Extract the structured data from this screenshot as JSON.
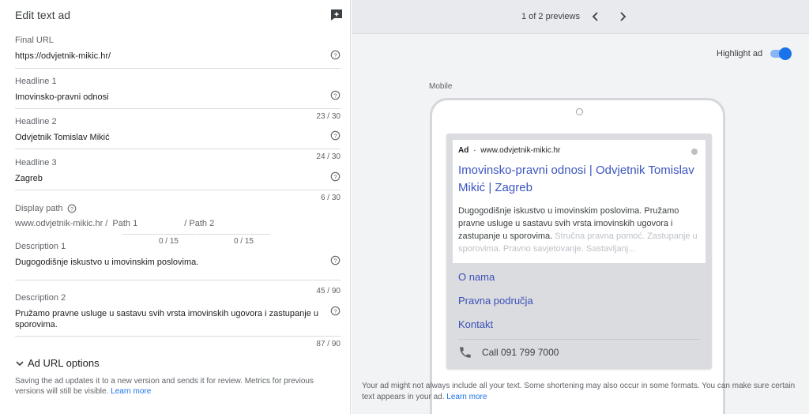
{
  "editor": {
    "title": "Edit text ad",
    "final_url": {
      "label": "Final URL",
      "value": "https://odvjetnik-mikic.hr/"
    },
    "headline1": {
      "label": "Headline 1",
      "value": "Imovinsko-pravni odnosi",
      "count": "23 / 30"
    },
    "headline2": {
      "label": "Headline 2",
      "value": "Odvjetnik Tomislav Mikić",
      "count": "24 / 30"
    },
    "headline3": {
      "label": "Headline 3",
      "value": "Zagreb",
      "count": "6 / 30"
    },
    "display_path": {
      "label": "Display path",
      "domain": "www.odvjetnik-mikic.hr /",
      "path1": "Path 1",
      "path2": "/ Path 2",
      "count1": "0 / 15",
      "count2": "0 / 15"
    },
    "description1": {
      "label": "Description 1",
      "value": "Dugogodišnje iskustvo u imovinskim poslovima.",
      "count": "45 / 90"
    },
    "description2": {
      "label": "Description 2",
      "value": "Pružamo pravne usluge u sastavu svih vrsta imovinskih ugovora i zastupanje u sporovima.",
      "count": "87 / 90"
    },
    "url_options": "Ad URL options",
    "note": "Saving the ad updates it to a new version and sends it for review. Metrics for previous versions will still be visible.",
    "learn_more": "Learn more"
  },
  "preview": {
    "counter": "1 of 2 previews",
    "highlight_label": "Highlight ad",
    "highlight_on": true,
    "device_label": "Mobile",
    "ad": {
      "badge": "Ad",
      "separator": "·",
      "display_url": "www.odvjetnik-mikic.hr",
      "headline": "Imovinsko-pravni odnosi | Odvjetnik Tomislav Mikić | Zagreb",
      "description": "Dugogodišnje iskustvo u imovinskim poslovima. Pružamo pravne usluge u sastavu svih vrsta imovinskih ugovora i zastupanje u sporovima.",
      "description_faded": "Stručna pravna pomoć. Zastupanje u sporovima. Pravno savjetovanje. Sastavljanj...",
      "sitelinks": [
        "O nama",
        "Pravna područja",
        "Kontakt"
      ],
      "call": "Call 091 799 7000"
    },
    "disclaimer": "Your ad might not always include all your text. Some shortening may also occur in some formats. You can make sure certain text appears in your ad.",
    "learn_more": "Learn more"
  },
  "colors": {
    "accent": "#1a73e8",
    "ad_link": "#3c55c0"
  }
}
